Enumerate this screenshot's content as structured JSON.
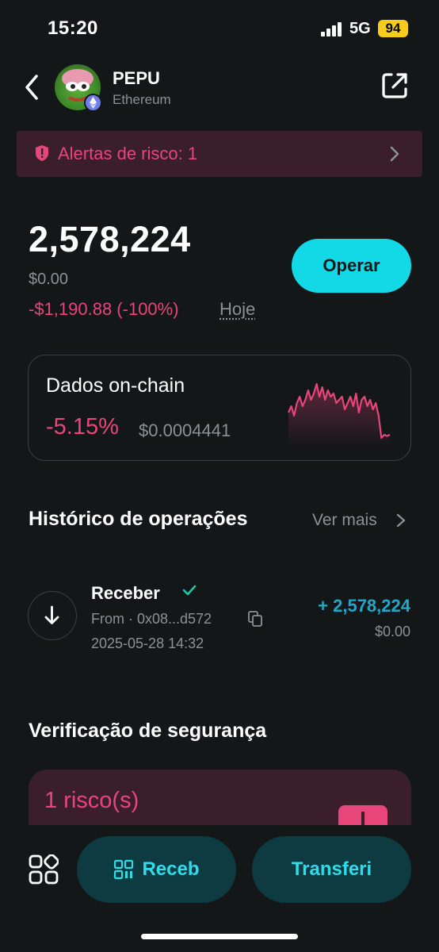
{
  "status_bar": {
    "time": "15:20",
    "network": "5G",
    "battery": "94"
  },
  "header": {
    "token_name": "PEPU",
    "chain": "Ethereum",
    "avatar_icon": "pepe-avatar-icon",
    "chain_badge_icon": "ethereum-icon"
  },
  "risk_alert": {
    "label": "Alertas de risco: 1"
  },
  "balance": {
    "amount": "2,578,224",
    "usd": "$0.00",
    "pnl": "-$1,190.88 (-100%)",
    "period": "Hoje",
    "trade_label": "Operar"
  },
  "onchain": {
    "title": "Dados on-chain",
    "change": "-5.15%",
    "price": "$0.0004441",
    "sparkline": [
      0.55,
      0.45,
      0.6,
      0.4,
      0.3,
      0.45,
      0.35,
      0.2,
      0.35,
      0.25,
      0.1,
      0.3,
      0.15,
      0.35,
      0.2,
      0.3,
      0.25,
      0.4,
      0.35,
      0.3,
      0.5,
      0.4,
      0.3,
      0.45,
      0.25,
      0.55,
      0.35,
      0.3,
      0.45,
      0.35,
      0.5,
      0.4,
      0.6,
      0.95,
      0.9,
      0.92,
      0.9
    ],
    "color": "#e8457a"
  },
  "history": {
    "title": "Histórico de operações",
    "see_more": "Ver mais",
    "transactions": [
      {
        "type": "Receber",
        "from": "From · 0x08...d572",
        "date": "2025-05-28 14:32",
        "amount": "+ 2,578,224",
        "usd": "$0.00"
      }
    ]
  },
  "security": {
    "title": "Verificação de segurança",
    "risks": "1 risco(s)"
  },
  "bottom_bar": {
    "receive_label": "Receb",
    "transfer_label": "Transferi"
  },
  "colors": {
    "background": "#141718",
    "accent": "#13d9e6",
    "danger": "#e8457a",
    "positive": "#1fa8c9"
  }
}
